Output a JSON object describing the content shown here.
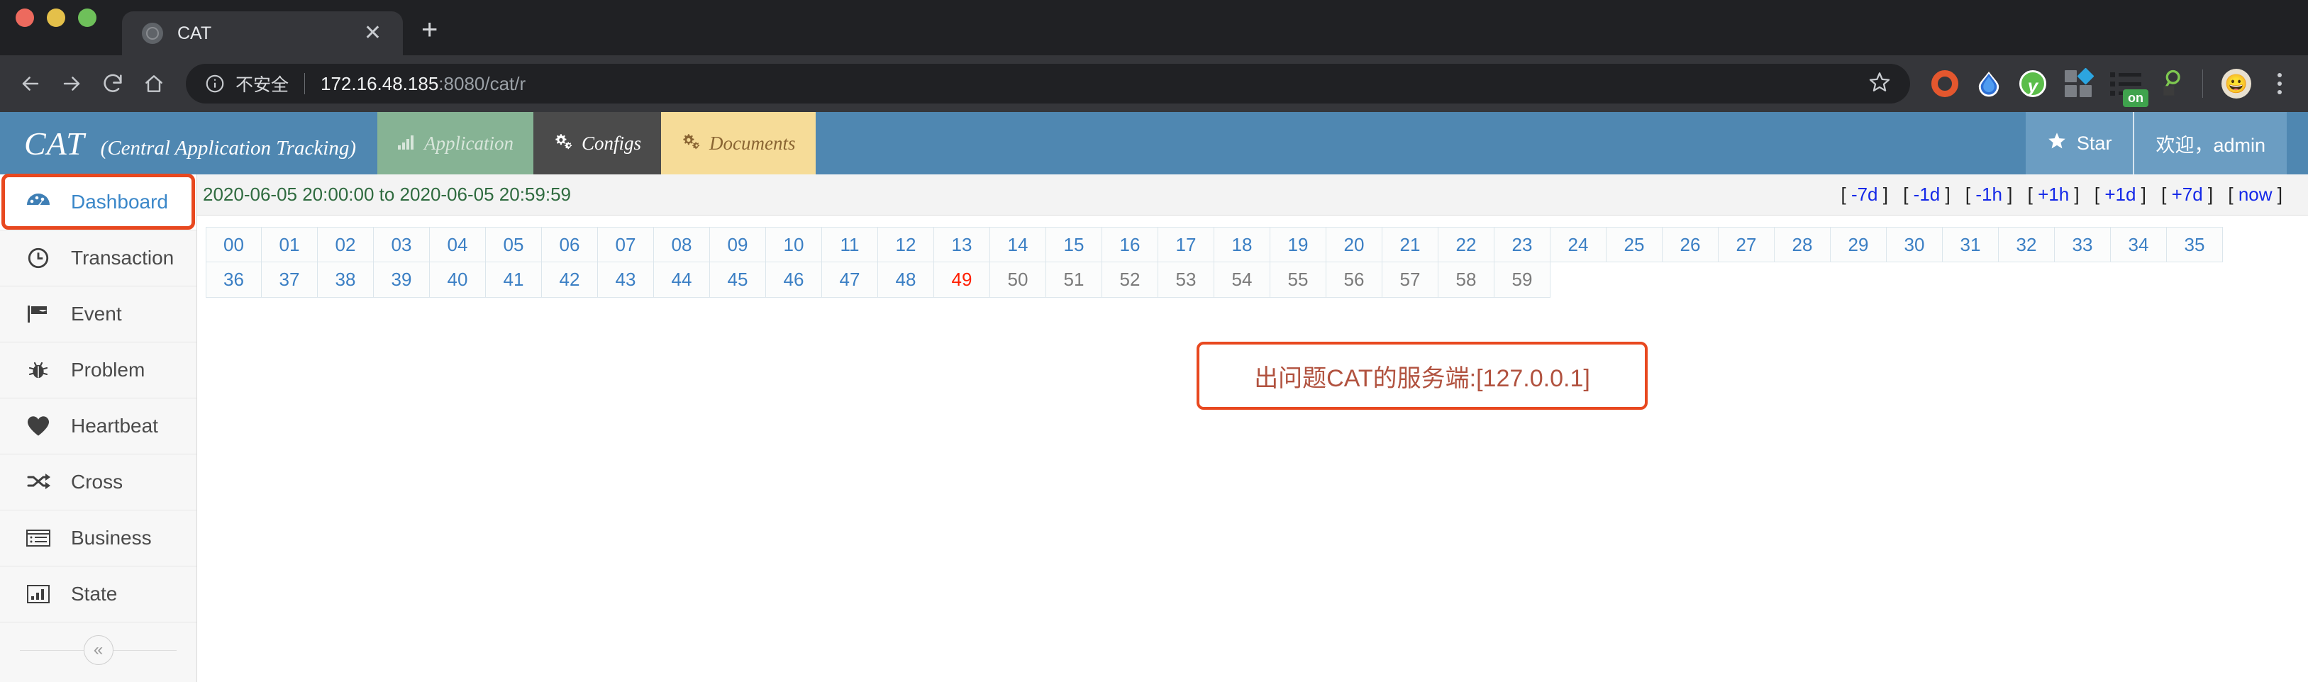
{
  "browser": {
    "tab": {
      "title": "CAT",
      "favicon_icon": "globe-icon",
      "close_icon": "close-icon"
    },
    "new_tab_icon": "plus-icon",
    "nav": {
      "back_icon": "back-arrow-icon",
      "forward_icon": "forward-arrow-icon",
      "reload_icon": "reload-icon",
      "home_icon": "home-icon"
    },
    "omnibox": {
      "info_icon": "info-circle-icon",
      "security_label": "不安全",
      "url_host": "172.16.48.185",
      "url_rest": ":8080/cat/r",
      "bookmark_icon": "star-outline-icon"
    },
    "extensions": [
      {
        "name": "opera-extension-icon",
        "label": "O"
      },
      {
        "name": "droplet-extension-icon",
        "label": ""
      },
      {
        "name": "yandex-extension-icon",
        "label": "y"
      },
      {
        "name": "grid-extension-icon",
        "label": ""
      },
      {
        "name": "list-extension-icon",
        "label": "",
        "badge": "on"
      },
      {
        "name": "magnifier-extension-icon",
        "label": ""
      }
    ],
    "profile_icon": "avatar-emoji-icon",
    "menu_icon": "kebab-menu-icon"
  },
  "app": {
    "brand_main": "CAT",
    "brand_sub": "(Central Application Tracking)",
    "nav": [
      {
        "label": "Application",
        "icon": "bar-chart-icon"
      },
      {
        "label": "Configs",
        "icon": "gears-icon"
      },
      {
        "label": "Documents",
        "icon": "gears-icon"
      }
    ],
    "star_label": "Star",
    "star_icon": "star-filled-icon",
    "welcome": "欢迎，admin"
  },
  "sidebar": {
    "items": [
      {
        "label": "Dashboard",
        "icon": "dashboard-gauge-icon",
        "active": true
      },
      {
        "label": "Transaction",
        "icon": "clock-icon",
        "active": false
      },
      {
        "label": "Event",
        "icon": "flag-icon",
        "active": false
      },
      {
        "label": "Problem",
        "icon": "bug-icon",
        "active": false
      },
      {
        "label": "Heartbeat",
        "icon": "heart-icon",
        "active": false
      },
      {
        "label": "Cross",
        "icon": "shuffle-icon",
        "active": false
      },
      {
        "label": "Business",
        "icon": "list-box-icon",
        "active": false
      },
      {
        "label": "State",
        "icon": "bar-chart-box-icon",
        "active": false
      }
    ],
    "collapse_icon": "double-chevron-left-icon"
  },
  "main": {
    "date_range": "2020-06-05 20:00:00 to 2020-06-05 20:59:59",
    "time_links": [
      "-7d",
      "-1d",
      "-1h",
      "+1h",
      "+1d",
      "+7d",
      "now"
    ],
    "minute_rows": [
      [
        "00",
        "01",
        "02",
        "03",
        "04",
        "05",
        "06",
        "07",
        "08",
        "09",
        "10",
        "11",
        "12",
        "13",
        "14",
        "15",
        "16",
        "17",
        "18",
        "19",
        "20",
        "21",
        "22",
        "23",
        "24",
        "25",
        "26",
        "27",
        "28",
        "29",
        "30",
        "31",
        "32",
        "33",
        "34",
        "35"
      ],
      [
        "36",
        "37",
        "38",
        "39",
        "40",
        "41",
        "42",
        "43",
        "44",
        "45",
        "46",
        "47",
        "48",
        "49",
        "50",
        "51",
        "52",
        "53",
        "54",
        "55",
        "56",
        "57",
        "58",
        "59"
      ]
    ],
    "minute_current": "49",
    "minute_disabled": [
      "50",
      "51",
      "52",
      "53",
      "54",
      "55",
      "56",
      "57",
      "58",
      "59"
    ],
    "alert_message": "出问题CAT的服务端:[127.0.0.1]"
  },
  "colors": {
    "header_blue": "#4f87b1",
    "accent_orange": "#e8481f",
    "link_blue": "#3b7fc4",
    "date_green": "#2f6b3f",
    "current_red": "#ff1f00",
    "alert_text": "#b1523f"
  }
}
